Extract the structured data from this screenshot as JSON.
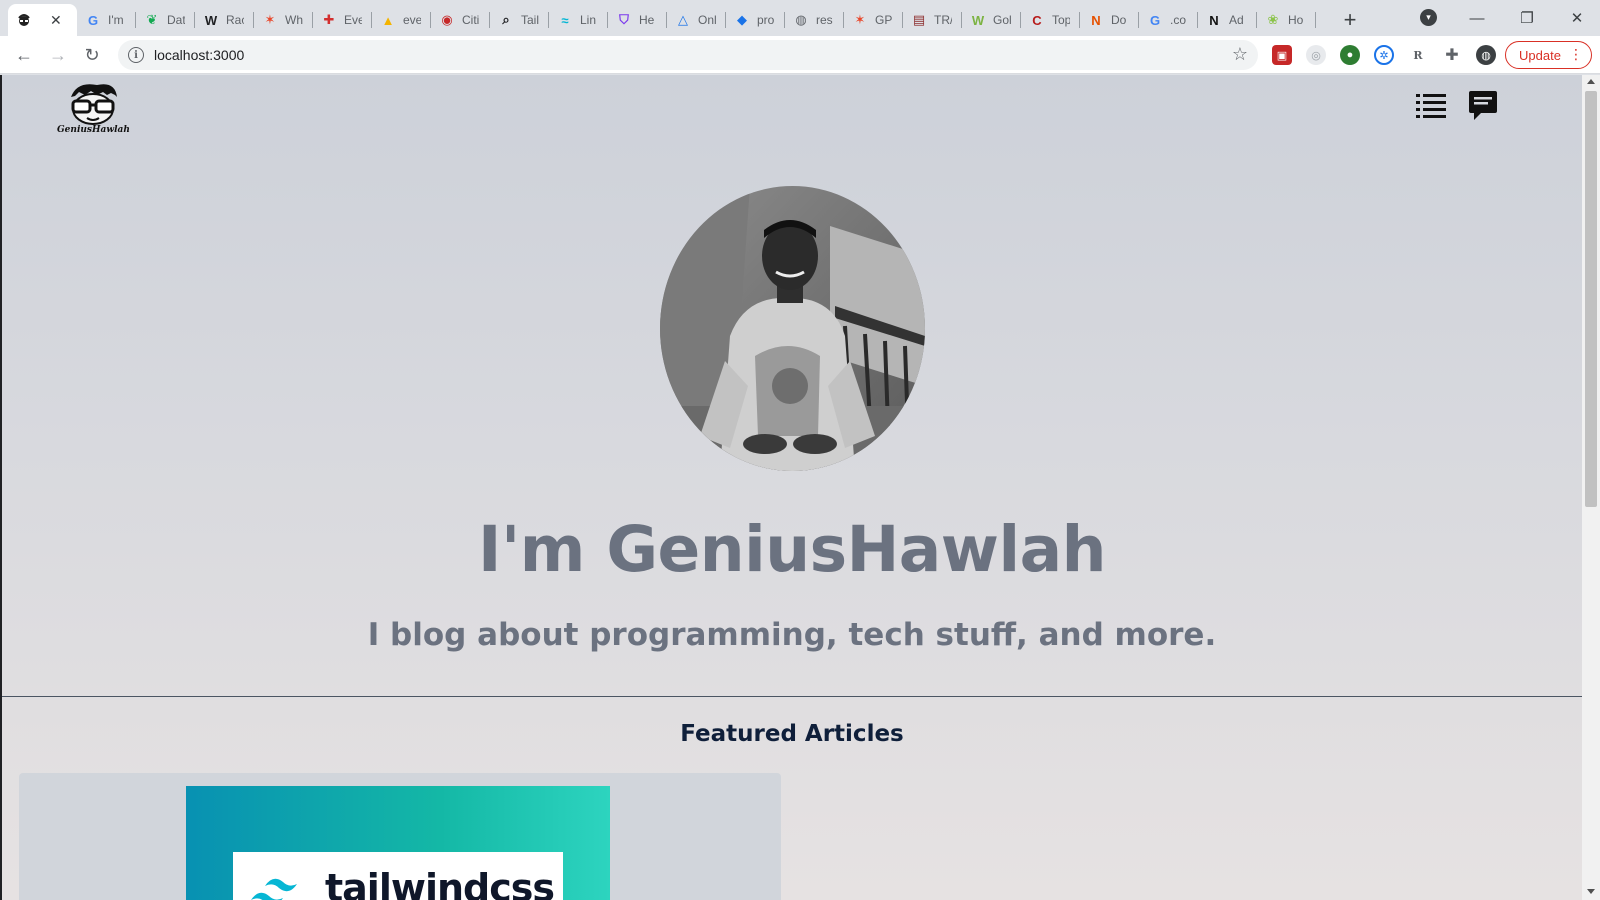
{
  "browser": {
    "tabs": [
      {
        "title": "",
        "active": true,
        "icon": "geniushawlah-favicon"
      },
      {
        "title": "I'm",
        "icon": "google-icon",
        "color": "#4285f4"
      },
      {
        "title": "Dat",
        "icon": "mongodb-leaf-icon",
        "color": "#13aa52"
      },
      {
        "title": "Rac",
        "icon": "wikipedia-icon",
        "color": "#202124"
      },
      {
        "title": "Wh",
        "icon": "gitlab-style-icon",
        "color": "#e8472b"
      },
      {
        "title": "Eve",
        "icon": "red-cross-icon",
        "color": "#d32f2f"
      },
      {
        "title": "eve",
        "icon": "drive-icon",
        "color": "#f4b400"
      },
      {
        "title": "Citi",
        "icon": "citi-globe-icon",
        "color": "#c62828"
      },
      {
        "title": "Tail",
        "icon": "search-icon",
        "color": "#202124"
      },
      {
        "title": "Lin",
        "icon": "tailwind-icon",
        "color": "#06b6d4"
      },
      {
        "title": "He",
        "icon": "shield-icon",
        "color": "#7c3aed"
      },
      {
        "title": "Onl",
        "icon": "triangle-icon",
        "color": "#1a73e8"
      },
      {
        "title": "pro",
        "icon": "diamond-icon",
        "color": "#1a73e8"
      },
      {
        "title": "res",
        "icon": "globe-icon",
        "color": "#5f6368"
      },
      {
        "title": "GP",
        "icon": "gitlab-style-icon",
        "color": "#e8472b"
      },
      {
        "title": "TR/",
        "icon": "train-icon",
        "color": "#8d2e2e"
      },
      {
        "title": "Gol",
        "icon": "w-icon",
        "color": "#7cb342"
      },
      {
        "title": "Top",
        "icon": "c-icon",
        "color": "#b71c1c"
      },
      {
        "title": "Do",
        "icon": "n-orange-icon",
        "color": "#e65100"
      },
      {
        "title": ".co",
        "icon": "google-icon",
        "color": "#4285f4"
      },
      {
        "title": "Ad",
        "icon": "n-black-icon",
        "color": "#111111"
      },
      {
        "title": "Ho",
        "icon": "paw-icon",
        "color": "#8bc34a"
      }
    ],
    "new_tab_label": "+",
    "url": "localhost:3000",
    "update_label": "Update"
  },
  "page": {
    "logo_text": "GeniusHawlah",
    "hero_title": "I'm GeniusHawlah",
    "hero_subtitle": "I blog about programming, tech stuff, and more.",
    "featured_heading": "Featured Articles",
    "article_thumb_brand": "tailwindcss"
  }
}
